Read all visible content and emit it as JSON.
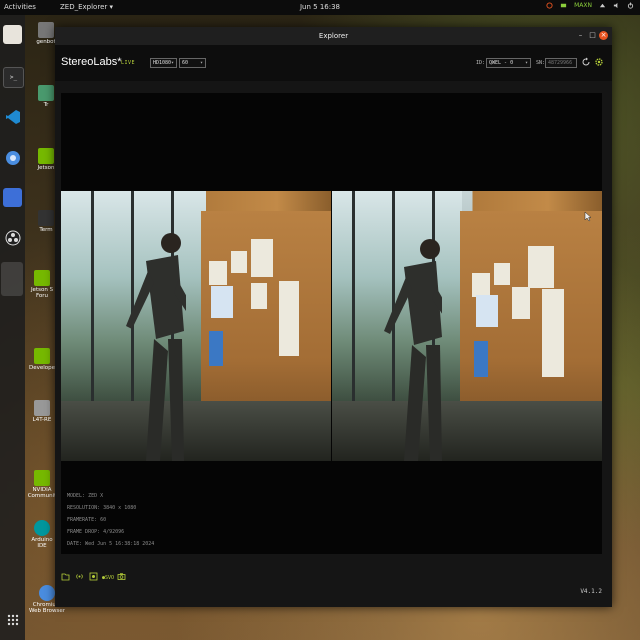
{
  "topbar": {
    "activities": "Activities",
    "app_menu": "ZED_Explorer ▾",
    "clock": "Jun 5  16:38",
    "power_mode": "MAXN"
  },
  "desktop_icons": [
    {
      "label": "genbot"
    },
    {
      "label": "Tr"
    },
    {
      "label": "Jetson"
    },
    {
      "label": "Term"
    },
    {
      "label": "Jetson S Foru"
    },
    {
      "label": "Develope"
    },
    {
      "label": "L4T-RE"
    },
    {
      "label": "NVIDIA Communit"
    },
    {
      "label": "Arduino IDE"
    },
    {
      "label": "Chromium Web Browser"
    }
  ],
  "window": {
    "title": "Explorer",
    "brand": "StereoLabs*",
    "status": "LIVE",
    "resolution_select": "HD1080",
    "fps_select": "60",
    "id_label": "ID:",
    "id_value": "QWEL - 0",
    "sn_label": "SN:",
    "sn_value": "48729966",
    "version": "V4.1.2"
  },
  "meta": {
    "model": "MODEL: ZED X",
    "resolution": "RESOLUTION: 3840 x 1080",
    "framerate": "FRAMERATE: 60",
    "frame_drop": "FRAME DROP: 4/92096",
    "date": "DATE: Wed Jun 5 16:38:18 2024"
  },
  "icons": {
    "record": "record-icon",
    "stream": "stream-icon",
    "capture": "camera-icon",
    "settings": "gear-icon"
  },
  "colors": {
    "accent": "#b6cf3a",
    "close": "#e95420"
  }
}
